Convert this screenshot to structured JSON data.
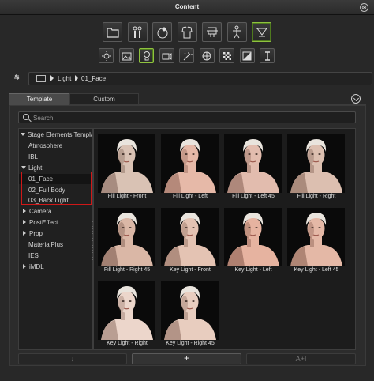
{
  "window": {
    "title": "Content",
    "close_glyph": "⊗"
  },
  "toolbar_top": [
    {
      "name": "project-icon",
      "active": false
    },
    {
      "name": "actor-icon",
      "active": false
    },
    {
      "name": "accessory-icon",
      "active": false
    },
    {
      "name": "cloth-icon",
      "active": false
    },
    {
      "name": "props-icon",
      "active": false
    },
    {
      "name": "motion-icon",
      "active": false
    },
    {
      "name": "stage-icon",
      "active": true
    }
  ],
  "toolbar_bottom": [
    {
      "name": "atmosphere-icon",
      "active": false
    },
    {
      "name": "image-icon",
      "active": false
    },
    {
      "name": "light-icon",
      "active": true
    },
    {
      "name": "camera-icon",
      "active": false
    },
    {
      "name": "effect-icon",
      "active": false
    },
    {
      "name": "ibl-icon",
      "active": false
    },
    {
      "name": "material-icon",
      "active": false
    },
    {
      "name": "ies-icon",
      "active": false
    },
    {
      "name": "imdl-icon",
      "active": false
    }
  ],
  "breadcrumb": {
    "parts": [
      "Light",
      "01_Face"
    ]
  },
  "tabs": [
    {
      "label": "Template"
    },
    {
      "label": "Custom"
    }
  ],
  "search": {
    "placeholder": "Search",
    "value": ""
  },
  "tree": [
    {
      "label": "Stage Elements Template",
      "expand": "down"
    },
    {
      "label": "Atmosphere",
      "expand": ""
    },
    {
      "label": "IBL",
      "expand": ""
    },
    {
      "label": "Light",
      "expand": "down"
    },
    {
      "label": "01_Face",
      "expand": "",
      "selected": true
    },
    {
      "label": "02_Full Body",
      "expand": ""
    },
    {
      "label": "03_Back Light",
      "expand": ""
    },
    {
      "label": "Camera",
      "expand": "right"
    },
    {
      "label": "PostEffect",
      "expand": "right"
    },
    {
      "label": "Prop",
      "expand": "right"
    },
    {
      "label": "MaterialPlus",
      "expand": ""
    },
    {
      "label": "IES",
      "expand": ""
    },
    {
      "label": "iMDL",
      "expand": "right"
    }
  ],
  "items": [
    {
      "label": "Fill Light - Front",
      "tone": "#d9c2b4",
      "shade": "#6b4c40"
    },
    {
      "label": "Fill Light - Left",
      "tone": "#e6b9a8",
      "shade": "#7a4f42"
    },
    {
      "label": "Fill Light - Left 45",
      "tone": "#e2bcae",
      "shade": "#6e4a3d"
    },
    {
      "label": "Fill Light - Right",
      "tone": "#dcbfb0",
      "shade": "#6d4b3f"
    },
    {
      "label": "Fill Light - Right 45",
      "tone": "#dab7a6",
      "shade": "#5e3e33"
    },
    {
      "label": "Key Light - Front",
      "tone": "#e4c3b3",
      "shade": "#734e40"
    },
    {
      "label": "Key Light - Left",
      "tone": "#e6b3a0",
      "shade": "#6c4336"
    },
    {
      "label": "Key Light - Left 45",
      "tone": "#e4b8a6",
      "shade": "#6f4638"
    },
    {
      "label": "Key Light - Right",
      "tone": "#ecd6cb",
      "shade": "#7d5a4d"
    },
    {
      "label": "Key Light - Right 45",
      "tone": "#e8cdbf",
      "shade": "#744f42"
    }
  ],
  "bottom_buttons": [
    {
      "label": "↓",
      "enabled": false
    },
    {
      "label": "+",
      "enabled": true
    },
    {
      "label": "A+I",
      "enabled": false
    }
  ]
}
